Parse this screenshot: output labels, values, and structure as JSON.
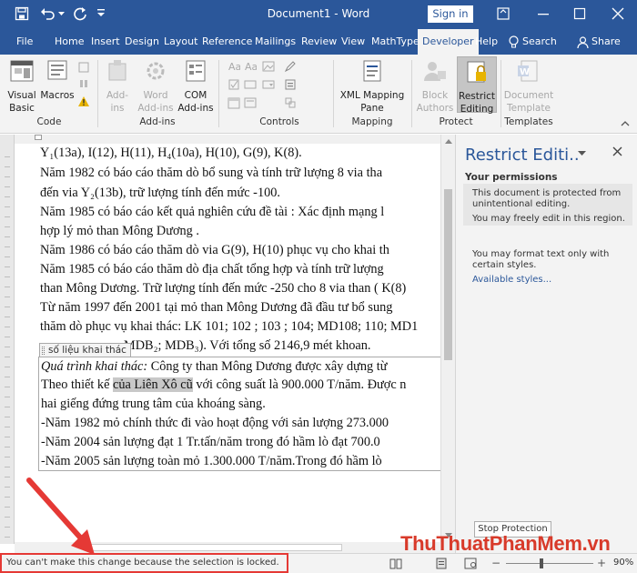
{
  "titlebar": {
    "title": "Document1  -  Word",
    "sign_in": "Sign in"
  },
  "tabs": [
    "File",
    "Home",
    "Insert",
    "Design",
    "Layout",
    "Reference",
    "Mailings",
    "Review",
    "View",
    "MathType",
    "Developer",
    "Help"
  ],
  "tell_me": "Search",
  "share": "Share",
  "ribbon": {
    "code": {
      "visual_basic": [
        "Visual",
        "Basic"
      ],
      "macros": "Macros",
      "group": "Code"
    },
    "addins": {
      "add_ins": [
        "Add-",
        "ins"
      ],
      "word_add_ins": [
        "Word",
        "Add-ins"
      ],
      "com_add_ins": [
        "COM",
        "Add-ins"
      ],
      "group": "Add-ins"
    },
    "controls": {
      "group": "Controls"
    },
    "mapping": {
      "xml_mapping_pane": [
        "XML Mapping",
        "Pane"
      ],
      "group": "Mapping"
    },
    "protect": {
      "block_authors": [
        "Block",
        "Authors"
      ],
      "restrict_editing": [
        "Restrict",
        "Editing"
      ],
      "group": "Protect"
    },
    "templates": {
      "document_template": [
        "Document",
        "Template"
      ],
      "group": "Templates"
    }
  },
  "document": {
    "lines": [
      "Y₁(13a), I(12), H(11), H₄(10a), H(10), G(9), K(8).",
      "       Năm 1982 có báo cáo thăm dò bổ sung và tính trữ lượng 8 via tha",
      "đến via Y₂(13b), trữ lượng tính đến mức -100.",
      "       Năm 1985 có báo cáo kết quả nghiên cứu đề tài : Xác định mạng l",
      "hợp lý mỏ than Mông Dương .",
      "       Năm 1986 có báo cáo thăm dò via G(9), H(10) phục vụ cho khai th",
      "       Năm 1985 có báo cáo thăm dò địa chất tổng hợp và tính trữ  lượng",
      "than Mông Dương. Trữ lượng tính đến mức -250 cho 8 via than ( K(8)",
      "       Từ năm 1997 đến 2001 tại mỏ than Mông Dương đã đầu tư bổ sung",
      "thăm dò phục vụ khai thác: LK 101; 102 ; 103 ; 104; MD108; 110; MD1",
      "MDB₂; MDB₃). Với tổng số 2146,9 mét khoan."
    ],
    "content_control_tag": "số liệu khai thác",
    "cc_lines": [
      {
        "italic": "Quá trình khai thác:",
        "rest": "  Công ty than Mông Dương được xây dựng từ"
      },
      {
        "pre": "Theo thiết kế ",
        "hl": "của Liên Xô cũ",
        "post": " với công suất là 900.000 T/năm. Được n"
      },
      {
        "text": "hai giếng đứng trung tâm của khoáng sàng."
      },
      {
        "text": "    -Năm 1982 mỏ chính thức đi vào hoạt động với sản lượng 273.000"
      },
      {
        "text": "    -Năm 2004 sản lượng đạt 1 Tr.tấn/năm trong đó hầm lò đạt  700.0"
      },
      {
        "text": "    -Năm 2005 sản lượng toàn mỏ 1.300.000 T/năm.Trong đó hầm lò"
      }
    ]
  },
  "pane": {
    "title": "Restrict Editi..",
    "section": "Your permissions",
    "p1": [
      "This document is protected from",
      "unintentional editing."
    ],
    "p2": "You may freely edit in this region.",
    "p3": [
      "You may format text only with",
      "certain styles."
    ],
    "link": "Available styles...",
    "stop_protection": "Stop Protection"
  },
  "status": {
    "message": "You can't make this change because the selection is locked.",
    "zoom": "90%"
  },
  "watermark": "ThuThuatPhanMem.vn",
  "colors": {
    "accent": "#2b579a",
    "annotation": "#e53935",
    "link": "#2b579a"
  }
}
